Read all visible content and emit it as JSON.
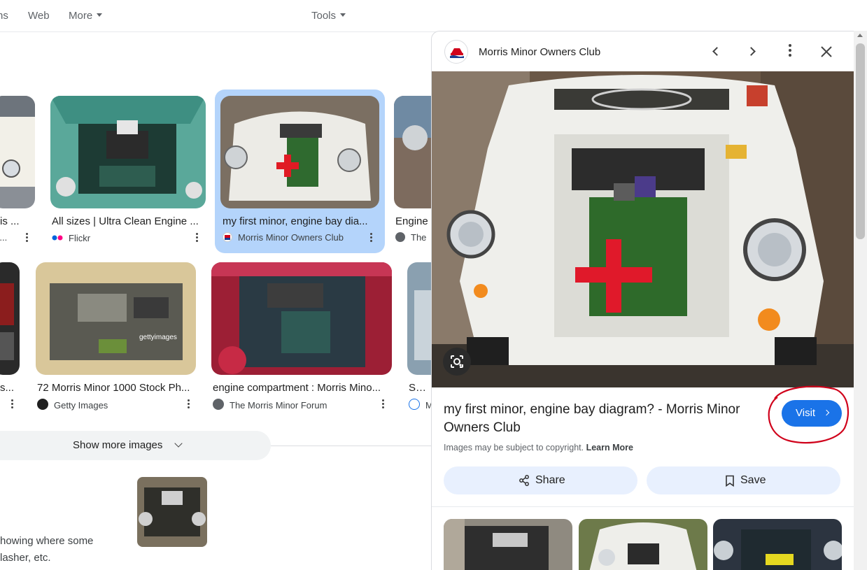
{
  "nav": {
    "tabs": [
      {
        "label": "ns"
      },
      {
        "label": "Web"
      },
      {
        "label": "More"
      },
      {
        "label": "Tools"
      }
    ]
  },
  "grid": {
    "row1": [
      {
        "title": "rris ...",
        "source": "is..."
      },
      {
        "title": "All sizes | Ultra Clean Engine ...",
        "source": "Flickr"
      },
      {
        "title": "my first minor, engine bay dia...",
        "source": "Morris Minor Owners Club"
      },
      {
        "title": "Engine",
        "source": "The"
      }
    ],
    "row2": [
      {
        "title": "s...",
        "source": ""
      },
      {
        "title": "72 Morris Minor 1000 Stock Ph...",
        "source": "Getty Images"
      },
      {
        "title": "engine compartment : Morris Mino...",
        "source": "The Morris Minor Forum"
      },
      {
        "title": "SOLI",
        "source": "M"
      }
    ]
  },
  "show_more": {
    "label": "Show more images"
  },
  "related": {
    "line1": "howing where some",
    "line2": "lasher, etc."
  },
  "panel": {
    "site_name": "Morris Minor Owners Club",
    "title": "my first minor, engine bay diagram? - Morris Minor Owners Club",
    "visit_label": "Visit",
    "copyright_text": "Images may be subject to copyright.",
    "learn_more": "Learn More",
    "share_label": "Share",
    "save_label": "Save"
  },
  "colors": {
    "accent": "#1a73e8",
    "selected_card": "#b4d4fb",
    "annotation_red": "#d0021b"
  }
}
